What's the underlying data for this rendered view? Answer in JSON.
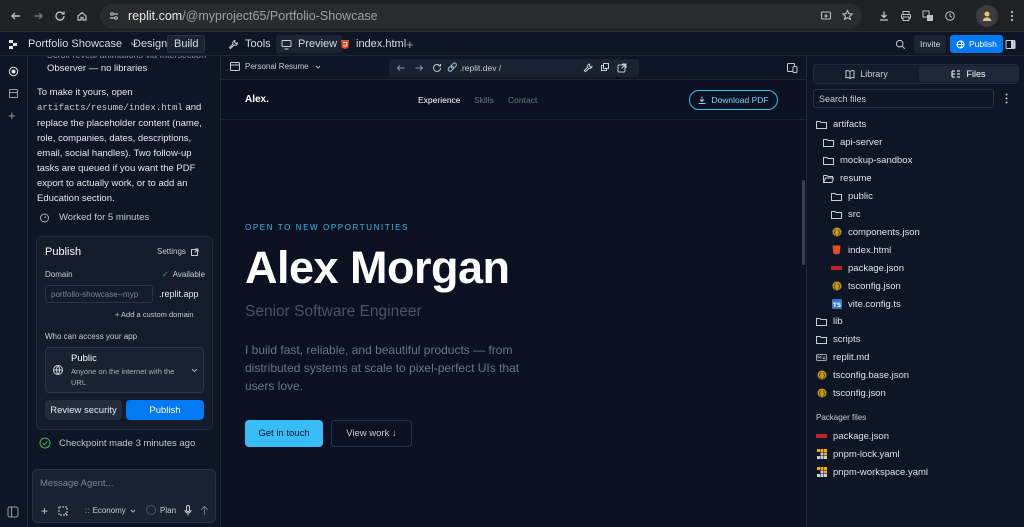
{
  "browser": {
    "url_host": "replit.com",
    "url_path": "/@myproject65/Portfolio-Showcase"
  },
  "app_bar": {
    "project_name": "Portfolio Showcase",
    "mode_design": "Design",
    "mode_build": "Build",
    "tab_tools": "Tools",
    "tab_preview": "Preview",
    "tab_index": "index.html",
    "invite": "Invite",
    "publish": "Publish"
  },
  "agent": {
    "truncated_line": "Observer — no libraries",
    "message_p1": "To make it yours, open",
    "message_code": "artifacts/resume/index.html",
    "message_p2": "and replace the placeholder content (name, role, companies, dates, descriptions, email, social handles). Two follow-up tasks are queued if you want the PDF export to actually work, or to add an Education section.",
    "worked_for": "Worked for 5 minutes",
    "publish_card": {
      "title": "Publish",
      "settings": "Settings",
      "domain_label": "Domain",
      "available": "Available",
      "domain_value": "portfolio-showcase--myp",
      "domain_suffix": ".replit.app",
      "add_domain": "+ Add a custom domain",
      "access_label": "Who can access your app",
      "access_title": "Public",
      "access_desc": "Anyone on the internet with the URL",
      "review_btn": "Review security",
      "publish_btn": "Publish"
    },
    "checkpoint": "Checkpoint made 3 minutes ago",
    "input_placeholder": "Message Agent...",
    "economy": "Economy",
    "plan": "Plan"
  },
  "preview_toolbar": {
    "view_select": "Personal Resume",
    "address": ".replit.dev /"
  },
  "site": {
    "logo": "Alex.",
    "nav": [
      "Experience",
      "Skills",
      "Contact"
    ],
    "download": "Download PDF",
    "kicker": "OPEN TO NEW OPPORTUNITIES",
    "name": "Alex Morgan",
    "role": "Senior Software Engineer",
    "bio": "I build fast, reliable, and beautiful products — from distributed systems at scale to pixel-perfect UIs that users love.",
    "cta_primary": "Get in touch",
    "cta_secondary": "View work ↓"
  },
  "files": {
    "tab_library": "Library",
    "tab_files": "Files",
    "search_placeholder": "Search files",
    "tree": [
      "artifacts",
      "api-server",
      "mockup-sandbox",
      "resume",
      "public",
      "src",
      "components.json",
      "index.html",
      "package.json",
      "tsconfig.json",
      "vite.config.ts",
      "lib",
      "scripts",
      "replit.md",
      "tsconfig.base.json",
      "tsconfig.json"
    ],
    "packager_heading": "Packager files",
    "packager": [
      "package.json",
      "pnpm-lock.yaml",
      "pnpm-workspace.yaml"
    ]
  },
  "colors": {
    "accent": "#0079f2",
    "site_accent": "#38bdf8",
    "bg": "#0e1525"
  }
}
